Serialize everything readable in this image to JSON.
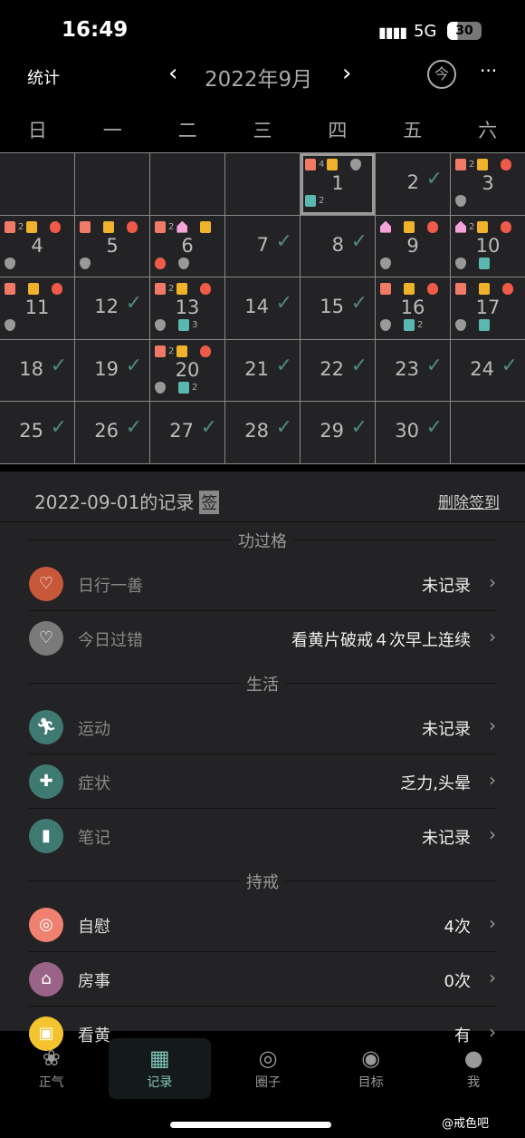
{
  "status": {
    "time": "16:49",
    "network": "5G",
    "battery": "30"
  },
  "header": {
    "stats": "统计",
    "month": "2022年9月",
    "today": "今",
    "more": "···",
    "prev": "‹",
    "next": "›"
  },
  "weekdays": [
    "日",
    "一",
    "二",
    "三",
    "四",
    "五",
    "六"
  ],
  "calendar": {
    "leading_blank": 4,
    "selected": 1,
    "days": [
      {
        "d": 1,
        "top": [
          [
            "roll",
            "4"
          ],
          [
            "monitor",
            ""
          ],
          [
            "gap",
            ""
          ],
          [
            "heart",
            ""
          ]
        ],
        "bottom": [
          [
            "med",
            "2"
          ]
        ]
      },
      {
        "d": 2,
        "check": true
      },
      {
        "d": 3,
        "top": [
          [
            "roll",
            "2"
          ],
          [
            "monitor",
            ""
          ],
          [
            "gap",
            ""
          ],
          [
            "fire",
            ""
          ]
        ],
        "bottom": [
          [
            "heart",
            ""
          ]
        ]
      },
      {
        "d": 4,
        "top": [
          [
            "roll",
            "2"
          ],
          [
            "monitor",
            ""
          ],
          [
            "gap",
            ""
          ],
          [
            "fire",
            ""
          ]
        ],
        "bottom": [
          [
            "heart",
            ""
          ]
        ]
      },
      {
        "d": 5,
        "top": [
          [
            "roll",
            ""
          ],
          [
            "gap",
            ""
          ],
          [
            "monitor",
            ""
          ],
          [
            "gap",
            ""
          ],
          [
            "fire",
            ""
          ]
        ],
        "bottom": [
          [
            "heart",
            ""
          ]
        ]
      },
      {
        "d": 6,
        "top": [
          [
            "roll",
            "2"
          ],
          [
            "house",
            ""
          ],
          [
            "gap",
            ""
          ],
          [
            "monitor",
            ""
          ]
        ],
        "bottom": [
          [
            "fire",
            ""
          ],
          [
            "gap",
            ""
          ],
          [
            "heart",
            ""
          ]
        ]
      },
      {
        "d": 7,
        "check": true
      },
      {
        "d": 8,
        "check": true
      },
      {
        "d": 9,
        "top": [
          [
            "house",
            ""
          ],
          [
            "gap",
            ""
          ],
          [
            "monitor",
            ""
          ],
          [
            "gap",
            ""
          ],
          [
            "fire",
            ""
          ]
        ],
        "bottom": [
          [
            "heart",
            ""
          ]
        ]
      },
      {
        "d": 10,
        "top": [
          [
            "house",
            "2"
          ],
          [
            "monitor",
            ""
          ],
          [
            "gap",
            ""
          ],
          [
            "fire",
            ""
          ]
        ],
        "bottom": [
          [
            "heart",
            ""
          ],
          [
            "gap",
            ""
          ],
          [
            "med",
            ""
          ]
        ]
      },
      {
        "d": 11,
        "top": [
          [
            "roll",
            ""
          ],
          [
            "gap",
            ""
          ],
          [
            "monitor",
            ""
          ],
          [
            "gap",
            ""
          ],
          [
            "fire",
            ""
          ]
        ],
        "bottom": [
          [
            "heart",
            ""
          ]
        ]
      },
      {
        "d": 12,
        "check": true
      },
      {
        "d": 13,
        "top": [
          [
            "roll",
            "2"
          ],
          [
            "monitor",
            ""
          ],
          [
            "gap",
            ""
          ],
          [
            "fire",
            ""
          ]
        ],
        "bottom": [
          [
            "heart",
            ""
          ],
          [
            "gap",
            ""
          ],
          [
            "med",
            "3"
          ]
        ]
      },
      {
        "d": 14,
        "check": true
      },
      {
        "d": 15,
        "check": true
      },
      {
        "d": 16,
        "top": [
          [
            "roll",
            ""
          ],
          [
            "gap",
            ""
          ],
          [
            "monitor",
            ""
          ],
          [
            "gap",
            ""
          ],
          [
            "fire",
            ""
          ]
        ],
        "bottom": [
          [
            "heart",
            ""
          ],
          [
            "gap",
            ""
          ],
          [
            "med",
            "2"
          ]
        ]
      },
      {
        "d": 17,
        "top": [
          [
            "roll",
            ""
          ],
          [
            "gap",
            ""
          ],
          [
            "monitor",
            ""
          ],
          [
            "gap",
            ""
          ],
          [
            "fire",
            ""
          ]
        ],
        "bottom": [
          [
            "heart",
            ""
          ],
          [
            "gap",
            ""
          ],
          [
            "med",
            ""
          ]
        ]
      },
      {
        "d": 18,
        "check": true
      },
      {
        "d": 19,
        "check": true
      },
      {
        "d": 20,
        "top": [
          [
            "roll",
            "2"
          ],
          [
            "monitor",
            ""
          ],
          [
            "gap",
            ""
          ],
          [
            "fire",
            ""
          ]
        ],
        "bottom": [
          [
            "heart",
            ""
          ],
          [
            "gap",
            ""
          ],
          [
            "med",
            "2"
          ]
        ]
      },
      {
        "d": 21,
        "check": true
      },
      {
        "d": 22,
        "check": true
      },
      {
        "d": 23,
        "check": true
      },
      {
        "d": 24,
        "check": true
      },
      {
        "d": 25,
        "check": true
      },
      {
        "d": 26,
        "check": true
      },
      {
        "d": 27,
        "check": true
      },
      {
        "d": 28,
        "check": true
      },
      {
        "d": 29,
        "check": true
      },
      {
        "d": 30,
        "check": true
      }
    ]
  },
  "record": {
    "title": "2022-09-01的记录",
    "sign": "签",
    "delete": "删除签到",
    "sections": [
      {
        "title": "功过格",
        "items": [
          {
            "label": "日行一善",
            "value": "未记录",
            "icon": "heart-icon",
            "glyph": "♡",
            "color": "#c8583a"
          },
          {
            "label": "今日过错",
            "value": "看黄片破戒４次早上连续",
            "icon": "broken-heart-icon",
            "glyph": "♡",
            "color": "#7a7a7a"
          }
        ]
      },
      {
        "title": "生活",
        "items": [
          {
            "label": "运动",
            "value": "未记录",
            "icon": "running-icon",
            "glyph": "🏃︎",
            "color": "#3f7a72"
          },
          {
            "label": "症状",
            "value": "乏力,头晕",
            "icon": "medkit-icon",
            "glyph": "✚",
            "color": "#3f7a72"
          },
          {
            "label": "笔记",
            "value": "未记录",
            "icon": "notebook-icon",
            "glyph": "▮",
            "color": "#3f7a72"
          }
        ]
      },
      {
        "title": "持戒",
        "items": [
          {
            "label": "自慰",
            "value": "4次",
            "icon": "toilet-roll-icon",
            "glyph": "◎",
            "color": "#f08070",
            "bright": true
          },
          {
            "label": "房事",
            "value": "0次",
            "icon": "house-icon",
            "glyph": "⌂",
            "color": "#9a6488",
            "bright": true
          },
          {
            "label": "看黄",
            "value": "有",
            "icon": "monitor-icon",
            "glyph": "▣",
            "color": "#f4c430",
            "bright": true
          }
        ]
      }
    ]
  },
  "nav": [
    {
      "label": "正气",
      "icon": "lotus-icon",
      "glyph": "❀"
    },
    {
      "label": "记录",
      "icon": "calendar-icon",
      "glyph": "▦",
      "active": true
    },
    {
      "label": "圈子",
      "icon": "circle-icon",
      "glyph": "◎"
    },
    {
      "label": "目标",
      "icon": "target-icon",
      "glyph": "◉"
    },
    {
      "label": "我",
      "icon": "person-icon",
      "glyph": "●"
    }
  ],
  "watermark": "@戒色吧"
}
